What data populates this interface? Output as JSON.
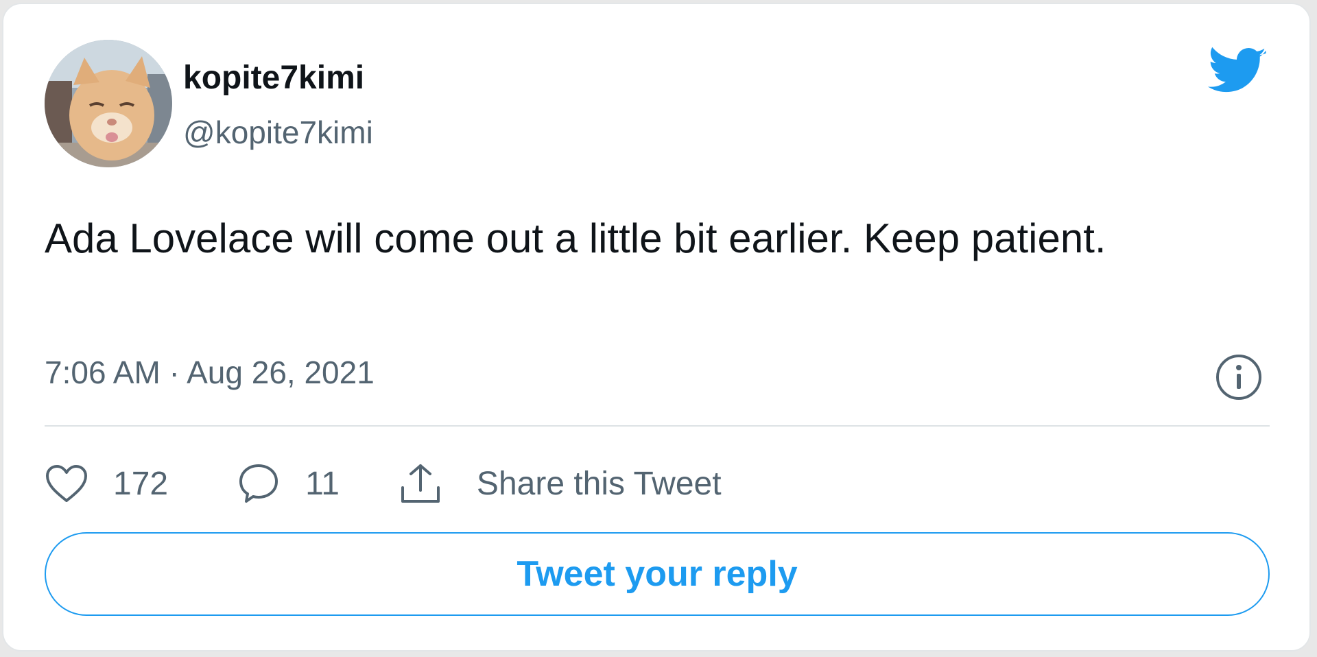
{
  "author": {
    "display_name": "kopite7kimi",
    "handle": "@kopite7kimi",
    "avatar_icon": "cat-avatar"
  },
  "brand": {
    "icon": "twitter-bird-icon",
    "color": "#1d9bf0"
  },
  "tweet": {
    "text": "Ada Lovelace will come out a little bit earlier. Keep patient.",
    "timestamp": "7:06 AM · Aug 26, 2021"
  },
  "actions": {
    "likes": "172",
    "replies": "11",
    "share_label": "Share this Tweet"
  },
  "reply_button": {
    "label": "Tweet your reply"
  },
  "colors": {
    "text_primary": "#0f1419",
    "text_secondary": "#536471",
    "accent": "#1d9bf0",
    "divider": "#dde2e5"
  }
}
